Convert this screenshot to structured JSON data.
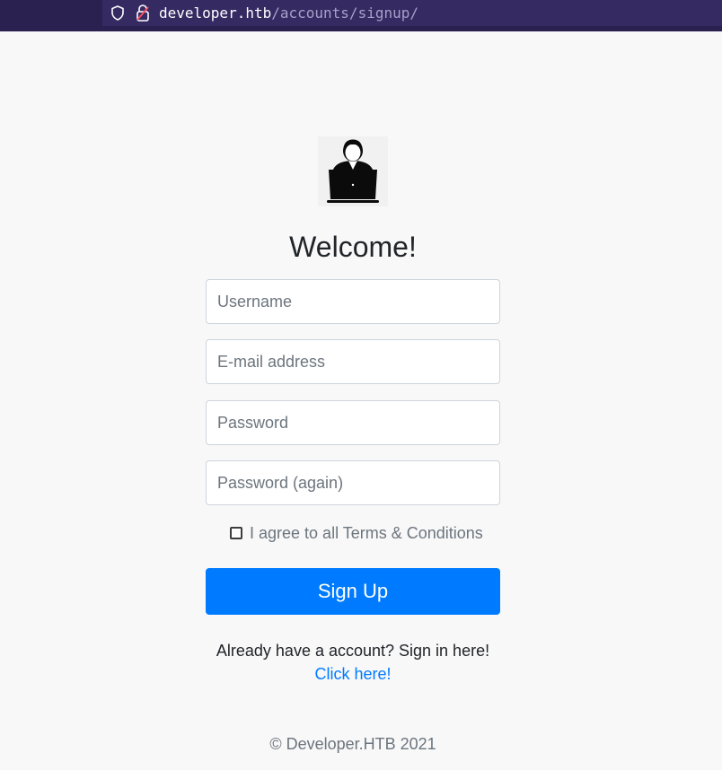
{
  "browser": {
    "url_host": "developer.htb",
    "url_path": "/accounts/signup/",
    "icons": [
      "shield-icon",
      "lock-icon"
    ]
  },
  "page": {
    "logo_icon": "developer-laptop-icon",
    "title": "Welcome!",
    "fields": {
      "username_placeholder": "Username",
      "email_placeholder": "E-mail address",
      "password_placeholder": "Password",
      "password2_placeholder": "Password (again)"
    },
    "agree_label": "I agree to all Terms & Conditions",
    "agree_checked": false,
    "signup_label": "Sign Up",
    "already_text": "Already have a account? Sign in here!",
    "click_link": "Click here!",
    "footer": "© Developer.HTB 2021"
  },
  "colors": {
    "browser_bar": "#2b2150",
    "primary": "#007bff",
    "background": "#f8f8f9"
  }
}
